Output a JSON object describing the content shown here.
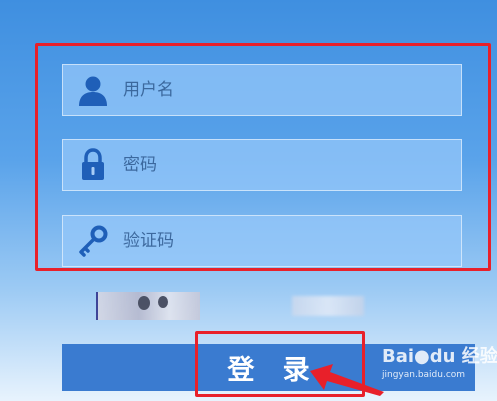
{
  "form": {
    "username": {
      "placeholder": "用户名",
      "icon": "user-icon"
    },
    "password": {
      "placeholder": "密码",
      "icon": "lock-icon"
    },
    "captcha": {
      "placeholder": "验证码",
      "icon": "key-icon"
    }
  },
  "login_button": {
    "label": "登 录"
  },
  "watermark": {
    "logo": "Bai●du 经验",
    "url": "jingyan.baidu.com"
  },
  "colors": {
    "accent": "#3a7bd0",
    "highlight": "#e8202a",
    "icon": "#1f5fb8"
  }
}
